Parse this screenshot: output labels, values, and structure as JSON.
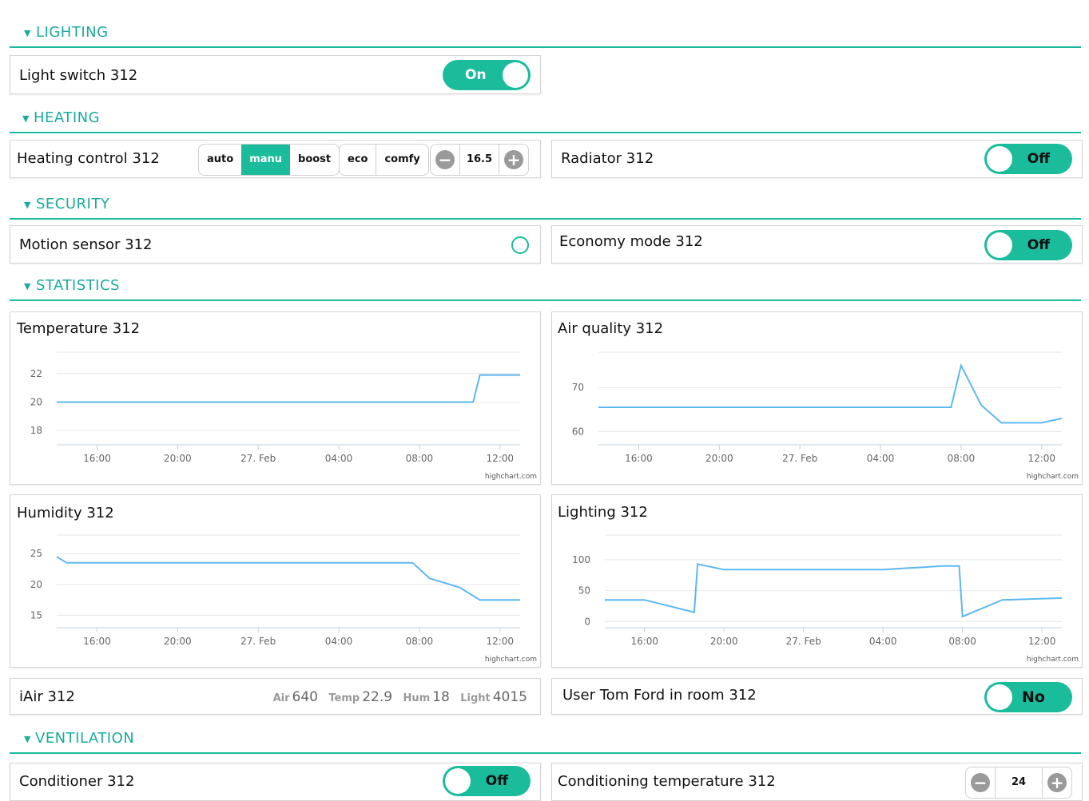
{
  "sections": {
    "lighting": "LIGHTING",
    "heating": "HEATING",
    "security": "SECURITY",
    "statistics": "STATISTICS",
    "ventilation": "VENTILATION"
  },
  "lighting": {
    "light_switch": {
      "label": "Light switch 312",
      "state": "On"
    }
  },
  "heating": {
    "control": {
      "label": "Heating control 312",
      "modes": [
        "auto",
        "manu",
        "boost"
      ],
      "active_mode": "manu",
      "presets": [
        "eco",
        "comfy"
      ],
      "setpoint": "16.5"
    },
    "radiator": {
      "label": "Radiator 312",
      "state": "Off"
    }
  },
  "security": {
    "motion": {
      "label": "Motion sensor 312"
    },
    "economy": {
      "label": "Economy mode 312",
      "state": "Off"
    }
  },
  "statistics": {
    "credit": "highchart.com",
    "x_ticks": [
      "16:00",
      "20:00",
      "27. Feb",
      "04:00",
      "08:00",
      "12:00"
    ],
    "temperature": {
      "title": "Temperature 312",
      "y_ticks": [
        "22",
        "20",
        "18"
      ]
    },
    "air": {
      "title": "Air quality 312",
      "y_ticks": [
        "70",
        "60"
      ]
    },
    "humidity": {
      "title": "Humidity 312",
      "y_ticks": [
        "25",
        "20",
        "15"
      ]
    },
    "lighting": {
      "title": "Lighting 312",
      "y_ticks": [
        "100",
        "50",
        "0"
      ]
    }
  },
  "chart_data": [
    {
      "type": "line",
      "title": "Temperature 312",
      "ylim": [
        17,
        23.5
      ],
      "x": [
        "14:00",
        "16:00",
        "20:00",
        "27. Feb 00:00",
        "04:00",
        "08:00",
        "10:40",
        "11:00",
        "13:00"
      ],
      "values": [
        20,
        20,
        20,
        20,
        20,
        20,
        20,
        21.9,
        21.9
      ]
    },
    {
      "type": "line",
      "title": "Air quality 312",
      "ylim": [
        57,
        78
      ],
      "x": [
        "14:00",
        "16:00",
        "20:00",
        "27. Feb 00:00",
        "04:00",
        "06:00",
        "07:30",
        "08:00",
        "09:00",
        "10:00",
        "12:00",
        "13:00"
      ],
      "values": [
        65.5,
        65.5,
        65.5,
        65.5,
        65.5,
        65.5,
        65.5,
        75,
        66,
        62,
        62,
        63
      ]
    },
    {
      "type": "line",
      "title": "Humidity 312",
      "ylim": [
        13,
        28
      ],
      "x": [
        "14:00",
        "14:30",
        "16:00",
        "20:00",
        "27. Feb 00:00",
        "04:00",
        "07:40",
        "08:30",
        "10:00",
        "11:00",
        "12:00",
        "13:00"
      ],
      "values": [
        24.5,
        23.5,
        23.5,
        23.5,
        23.5,
        23.5,
        23.5,
        21,
        19.5,
        17.5,
        17.5,
        17.5
      ]
    },
    {
      "type": "line",
      "title": "Lighting 312",
      "ylim": [
        -10,
        140
      ],
      "x": [
        "14:00",
        "16:00",
        "18:30",
        "18:40",
        "20:00",
        "27. Feb 00:00",
        "04:00",
        "07:00",
        "07:50",
        "08:00",
        "10:00",
        "13:00"
      ],
      "values": [
        35,
        35,
        15,
        93,
        84,
        84,
        84,
        90,
        90,
        8,
        35,
        38
      ]
    }
  ],
  "iair": {
    "label": "iAir 312",
    "air_key": "Air",
    "air_val": "640",
    "temp_key": "Temp",
    "temp_val": "22.9",
    "hum_key": "Hum",
    "hum_val": "18",
    "light_key": "Light",
    "light_val": "4015"
  },
  "user": {
    "label": "User Tom Ford in room 312",
    "state": "No"
  },
  "ventilation": {
    "conditioner": {
      "label": "Conditioner 312",
      "state": "Off"
    },
    "cond_temp": {
      "label": "Conditioning temperature 312",
      "value": "24"
    }
  },
  "colors": {
    "accent": "#1abc9c",
    "series": "#5cb8f0"
  }
}
